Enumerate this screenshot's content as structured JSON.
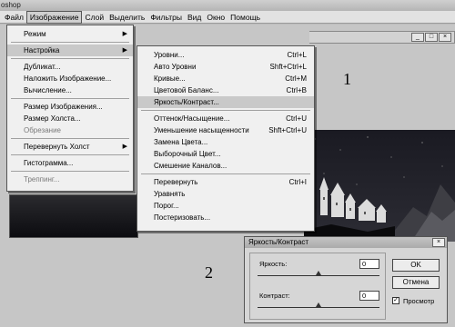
{
  "titlebar": {
    "title": "oshop"
  },
  "menubar": {
    "items": [
      "Файл",
      "Изображение",
      "Слой",
      "Выделить",
      "Фильтры",
      "Вид",
      "Окно",
      "Помощь"
    ]
  },
  "image_menu": {
    "items": [
      {
        "label": "Режим",
        "submenu": true
      },
      {
        "label": "Настройка",
        "submenu": true,
        "highlighted": true
      },
      {
        "label": "Дубликат..."
      },
      {
        "label": "Наложить Изображение..."
      },
      {
        "label": "Вычисление..."
      },
      {
        "label": "Размер Изображения..."
      },
      {
        "label": "Размер Холста..."
      },
      {
        "label": "Обрезание",
        "disabled": true
      },
      {
        "label": "Перевернуть Холст",
        "submenu": true
      },
      {
        "label": "Гистограмма..."
      },
      {
        "label": "Треппинг...",
        "disabled": true
      }
    ]
  },
  "adjust_menu": {
    "items": [
      {
        "label": "Уровни...",
        "shortcut": "Ctrl+L"
      },
      {
        "label": "Авто Уровни",
        "shortcut": "Shft+Ctrl+L"
      },
      {
        "label": "Кривые...",
        "shortcut": "Ctrl+M"
      },
      {
        "label": "Цветовой Баланс...",
        "shortcut": "Ctrl+B"
      },
      {
        "label": "Яркость/Контраст...",
        "shortcut": "",
        "highlighted": true
      },
      {
        "label": "Оттенок/Насыщение...",
        "shortcut": "Ctrl+U"
      },
      {
        "label": "Уменьшение насыщенности",
        "shortcut": "Shft+Ctrl+U"
      },
      {
        "label": "Замена Цвета...",
        "shortcut": ""
      },
      {
        "label": "Выборочный Цвет...",
        "shortcut": ""
      },
      {
        "label": "Смешение Каналов...",
        "shortcut": ""
      },
      {
        "label": "Перевернуть",
        "shortcut": "Ctrl+I"
      },
      {
        "label": "Уравнять",
        "shortcut": ""
      },
      {
        "label": "Порог...",
        "shortcut": ""
      },
      {
        "label": "Постеризовать...",
        "shortcut": ""
      }
    ]
  },
  "annotations": {
    "one": "1",
    "two": "2"
  },
  "dialog": {
    "title": "Яркость/Контраст",
    "brightness_label": "Яркость:",
    "brightness_value": "0",
    "contrast_label": "Контраст:",
    "contrast_value": "0",
    "ok_label": "OK",
    "cancel_label": "Отмена",
    "preview_label": "Просмотр",
    "preview_checked": true
  }
}
